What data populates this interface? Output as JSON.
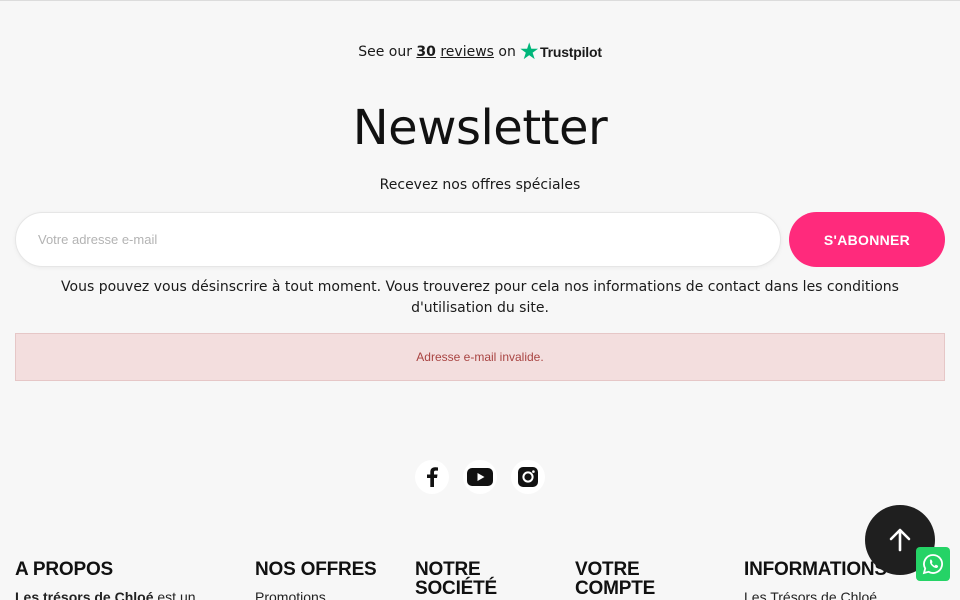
{
  "trustpilot": {
    "prefix": "See our",
    "count": "30",
    "reviews": "reviews",
    "on": "on",
    "brand": "Trustpilot"
  },
  "newsletter": {
    "title": "Newsletter",
    "subtitle": "Recevez nos offres spéciales",
    "email_placeholder": "Votre adresse e-mail",
    "subscribe_label": "S'ABONNER",
    "note": "Vous pouvez vous désinscrire à tout moment. Vous trouverez pour cela nos informations de contact dans les conditions d'utilisation du site.",
    "error": "Adresse e-mail invalide."
  },
  "socials": [
    {
      "icon": "facebook-icon"
    },
    {
      "icon": "youtube-icon"
    },
    {
      "icon": "instagram-icon"
    }
  ],
  "footer": {
    "about": {
      "title": "A PROPOS",
      "line_bold": "Les trésors de Chloé",
      "line_rest": " est un"
    },
    "offers": {
      "title": "NOS OFFRES",
      "line": "Promotions"
    },
    "company": {
      "title": "NOTRE SOCIÉTÉ"
    },
    "account": {
      "title": "VOTRE COMPTE"
    },
    "info": {
      "title": "INFORMATIONS",
      "line": "Les Trésors de Chloé"
    }
  },
  "colors": {
    "accent": "#ff2a7c",
    "alert_bg": "#f3dede",
    "alert_text": "#a94442",
    "trustpilot_green": "#00b67a",
    "whatsapp_green": "#25d366"
  }
}
